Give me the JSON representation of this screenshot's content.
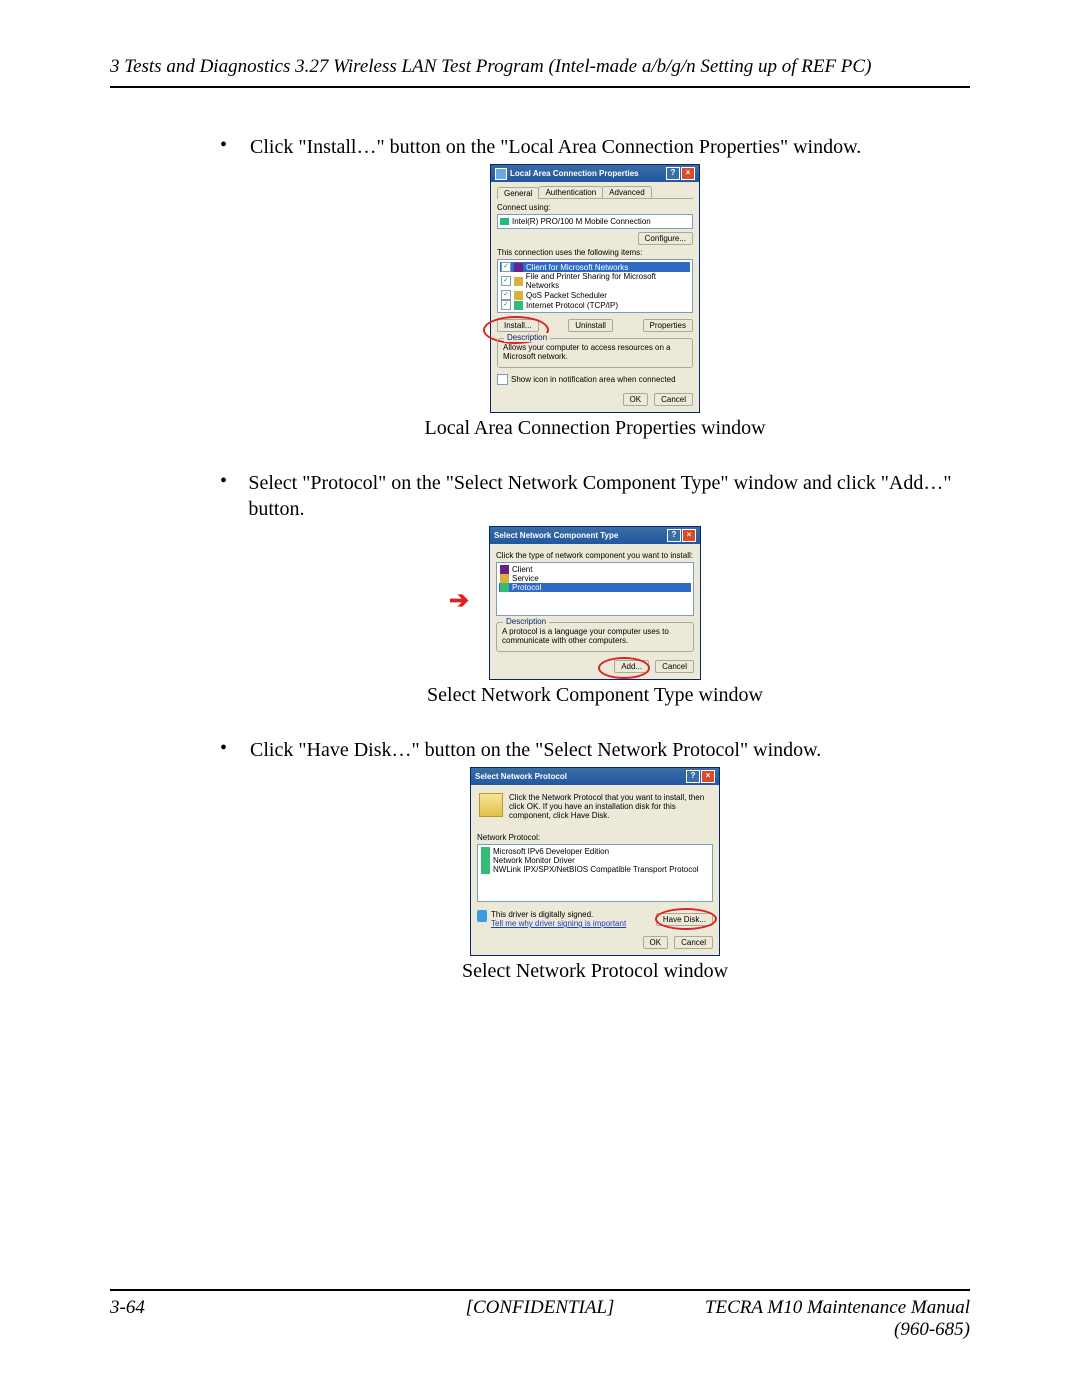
{
  "header": "3 Tests and Diagnostics   3.27 Wireless LAN Test Program (Intel-made a/b/g/n Setting up of REF PC)",
  "bullets": {
    "b1": "Click \"Install…\" button on the \"Local Area Connection Properties\" window.",
    "b2": "Select \"Protocol\" on the \"Select Network Component Type\" window and click \"Add…\" button.",
    "b3": "Click \"Have Disk…\" button on the \"Select Network Protocol\" window."
  },
  "captions": {
    "c1": "Local Area Connection Properties window",
    "c2": "Select Network Component Type window",
    "c3": "Select Network Protocol window"
  },
  "dlg1": {
    "title": "Local Area Connection Properties",
    "tabs": {
      "t1": "General",
      "t2": "Authentication",
      "t3": "Advanced"
    },
    "connect_label": "Connect using:",
    "nic": "Intel(R) PRO/100 M Mobile Connection",
    "configure": "Configure...",
    "items_label": "This connection uses the following items:",
    "items": {
      "i1": "Client for Microsoft Networks",
      "i2": "File and Printer Sharing for Microsoft Networks",
      "i3": "QoS Packet Scheduler",
      "i4": "Internet Protocol (TCP/IP)"
    },
    "install": "Install...",
    "uninstall": "Uninstall",
    "properties": "Properties",
    "desc_title": "Description",
    "desc_text": "Allows your computer to access resources on a Microsoft network.",
    "show_icon": "Show icon in notification area when connected",
    "ok": "OK",
    "cancel": "Cancel"
  },
  "dlg2": {
    "title": "Select Network Component Type",
    "instruction": "Click the type of network component you want to install:",
    "items": {
      "i1": "Client",
      "i2": "Service",
      "i3": "Protocol"
    },
    "desc_title": "Description",
    "desc_text": "A protocol is a language your computer uses to communicate with other computers.",
    "add": "Add...",
    "cancel": "Cancel"
  },
  "dlg3": {
    "title": "Select Network Protocol",
    "instruction": "Click the Network Protocol that you want to install, then click OK. If you have an installation disk for this component, click Have Disk.",
    "list_label": "Network Protocol:",
    "items": {
      "i1": "Microsoft IPv6 Developer Edition",
      "i2": "Network Monitor Driver",
      "i3": "NWLink IPX/SPX/NetBIOS Compatible Transport Protocol"
    },
    "signed": "This driver is digitally signed.",
    "tell_me": "Tell me why driver signing is important",
    "have_disk": "Have Disk...",
    "ok": "OK",
    "cancel": "Cancel"
  },
  "footer": {
    "page": "3-64",
    "confidential": "[CONFIDENTIAL]",
    "manual": "TECRA M10 Maintenance Manual (960-685)"
  }
}
